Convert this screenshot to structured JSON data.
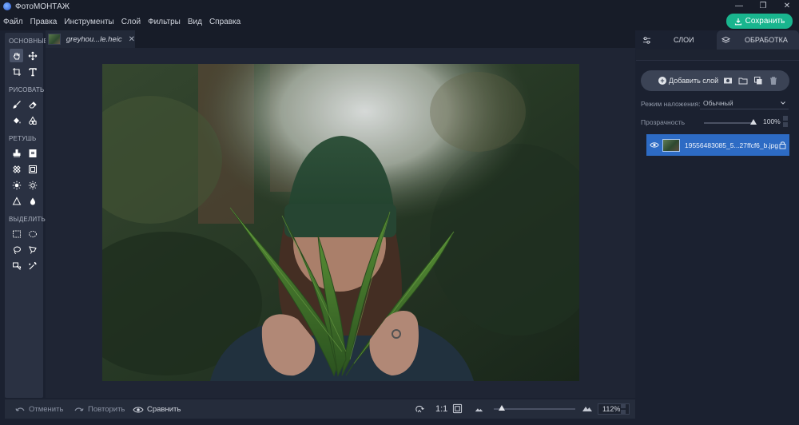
{
  "window": {
    "title": "ФотоМОНТАЖ",
    "minimize": "—",
    "restore": "❐",
    "close": "✕"
  },
  "menu": {
    "items": [
      "Файл",
      "Правка",
      "Инструменты",
      "Слой",
      "Фильтры",
      "Вид",
      "Справка"
    ],
    "save_label": "Сохранить"
  },
  "tools": {
    "sections": [
      "ОСНОВНЫЕ",
      "РИСОВАТЬ",
      "РЕТУШЬ",
      "ВЫДЕЛИТЬ"
    ]
  },
  "document": {
    "tab_name": "greyhou...le.heic",
    "close": "✕"
  },
  "bottombar": {
    "undo_label": "Отменить",
    "redo_label": "Повторить",
    "compare_label": "Сравнить",
    "actual_size": "1:1",
    "zoom": "112%"
  },
  "right_panel": {
    "tab_layers": "СЛОИ",
    "tab_processing": "ОБРАБОТКА",
    "add_layer_label": "Добавить слой",
    "blend_mode_label": "Режим наложения:",
    "blend_mode_value": "Обычный",
    "opacity_label": "Прозрачность",
    "opacity_value": "100%",
    "layer_name": "19556483085_5...27ffcf6_b.jpg"
  },
  "colors": {
    "accent": "#19b58e",
    "selection": "#2d6bc4",
    "panel": "#2a3142",
    "background": "#1b2130"
  }
}
